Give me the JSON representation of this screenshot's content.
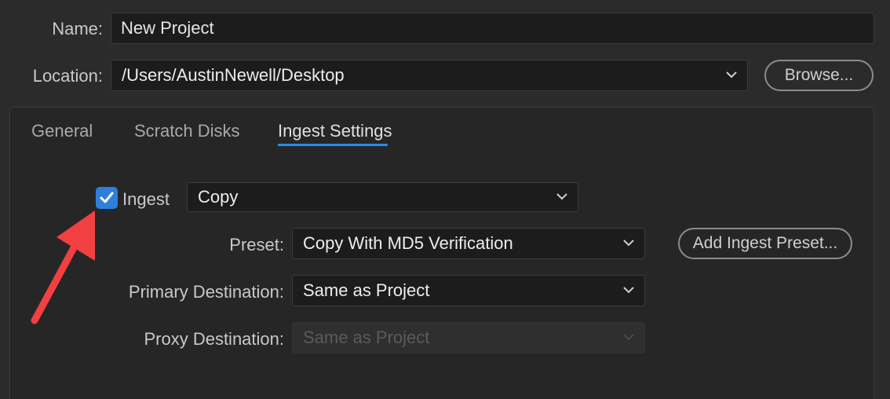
{
  "project": {
    "name_label": "Name:",
    "name_value": "New Project",
    "location_label": "Location:",
    "location_value": "/Users/AustinNewell/Desktop",
    "browse_label": "Browse..."
  },
  "tabs": [
    {
      "label": "General",
      "active": false
    },
    {
      "label": "Scratch Disks",
      "active": false
    },
    {
      "label": "Ingest Settings",
      "active": true
    }
  ],
  "ingest": {
    "checkbox_label": "Ingest",
    "checked": true,
    "mode_value": "Copy",
    "preset_label": "Preset:",
    "preset_value": "Copy With MD5 Verification",
    "add_preset_label": "Add Ingest Preset...",
    "primary_label": "Primary Destination:",
    "primary_value": "Same as Project",
    "proxy_label": "Proxy Destination:",
    "proxy_value": "Same as Project",
    "proxy_disabled": true
  },
  "colors": {
    "accent": "#2d8ceb",
    "checkbox": "#2e7fdc",
    "annotation_arrow": "#f24040"
  },
  "icons": {
    "dropdown": "chevron-down-icon",
    "check": "checkmark-icon",
    "annotation": "red-arrow-icon"
  }
}
